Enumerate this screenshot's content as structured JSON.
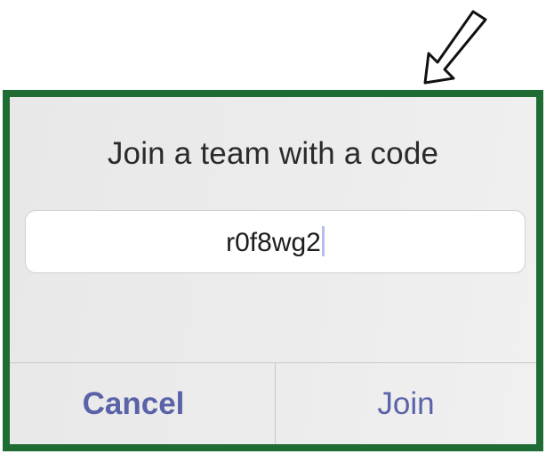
{
  "dialog": {
    "title": "Join a team with a code",
    "code_value": "r0f8wg2",
    "cancel_label": "Cancel",
    "join_label": "Join"
  },
  "colors": {
    "frame_border": "#1e6b34",
    "button_text": "#5a62a8",
    "caret": "#b6bdf0"
  },
  "icons": {
    "pointer_arrow": "arrow-down-left-icon"
  }
}
